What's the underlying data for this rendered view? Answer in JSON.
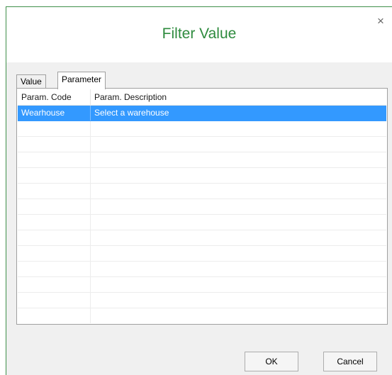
{
  "dialog": {
    "title": "Filter Value",
    "close_glyph": "×"
  },
  "tabs": [
    {
      "label": "Value",
      "active": false
    },
    {
      "label": "Parameter",
      "active": true
    }
  ],
  "grid": {
    "columns": [
      "Param. Code",
      "Param. Description"
    ],
    "rows": [
      {
        "code": "Wearhouse",
        "description": "Select a warehouse",
        "selected": true
      }
    ],
    "empty_rows": 13,
    "selection_color": "#3399ff"
  },
  "buttons": {
    "ok": "OK",
    "cancel": "Cancel"
  },
  "colors": {
    "title": "#2e8b3e",
    "accent_border": "#3f8f4a"
  }
}
